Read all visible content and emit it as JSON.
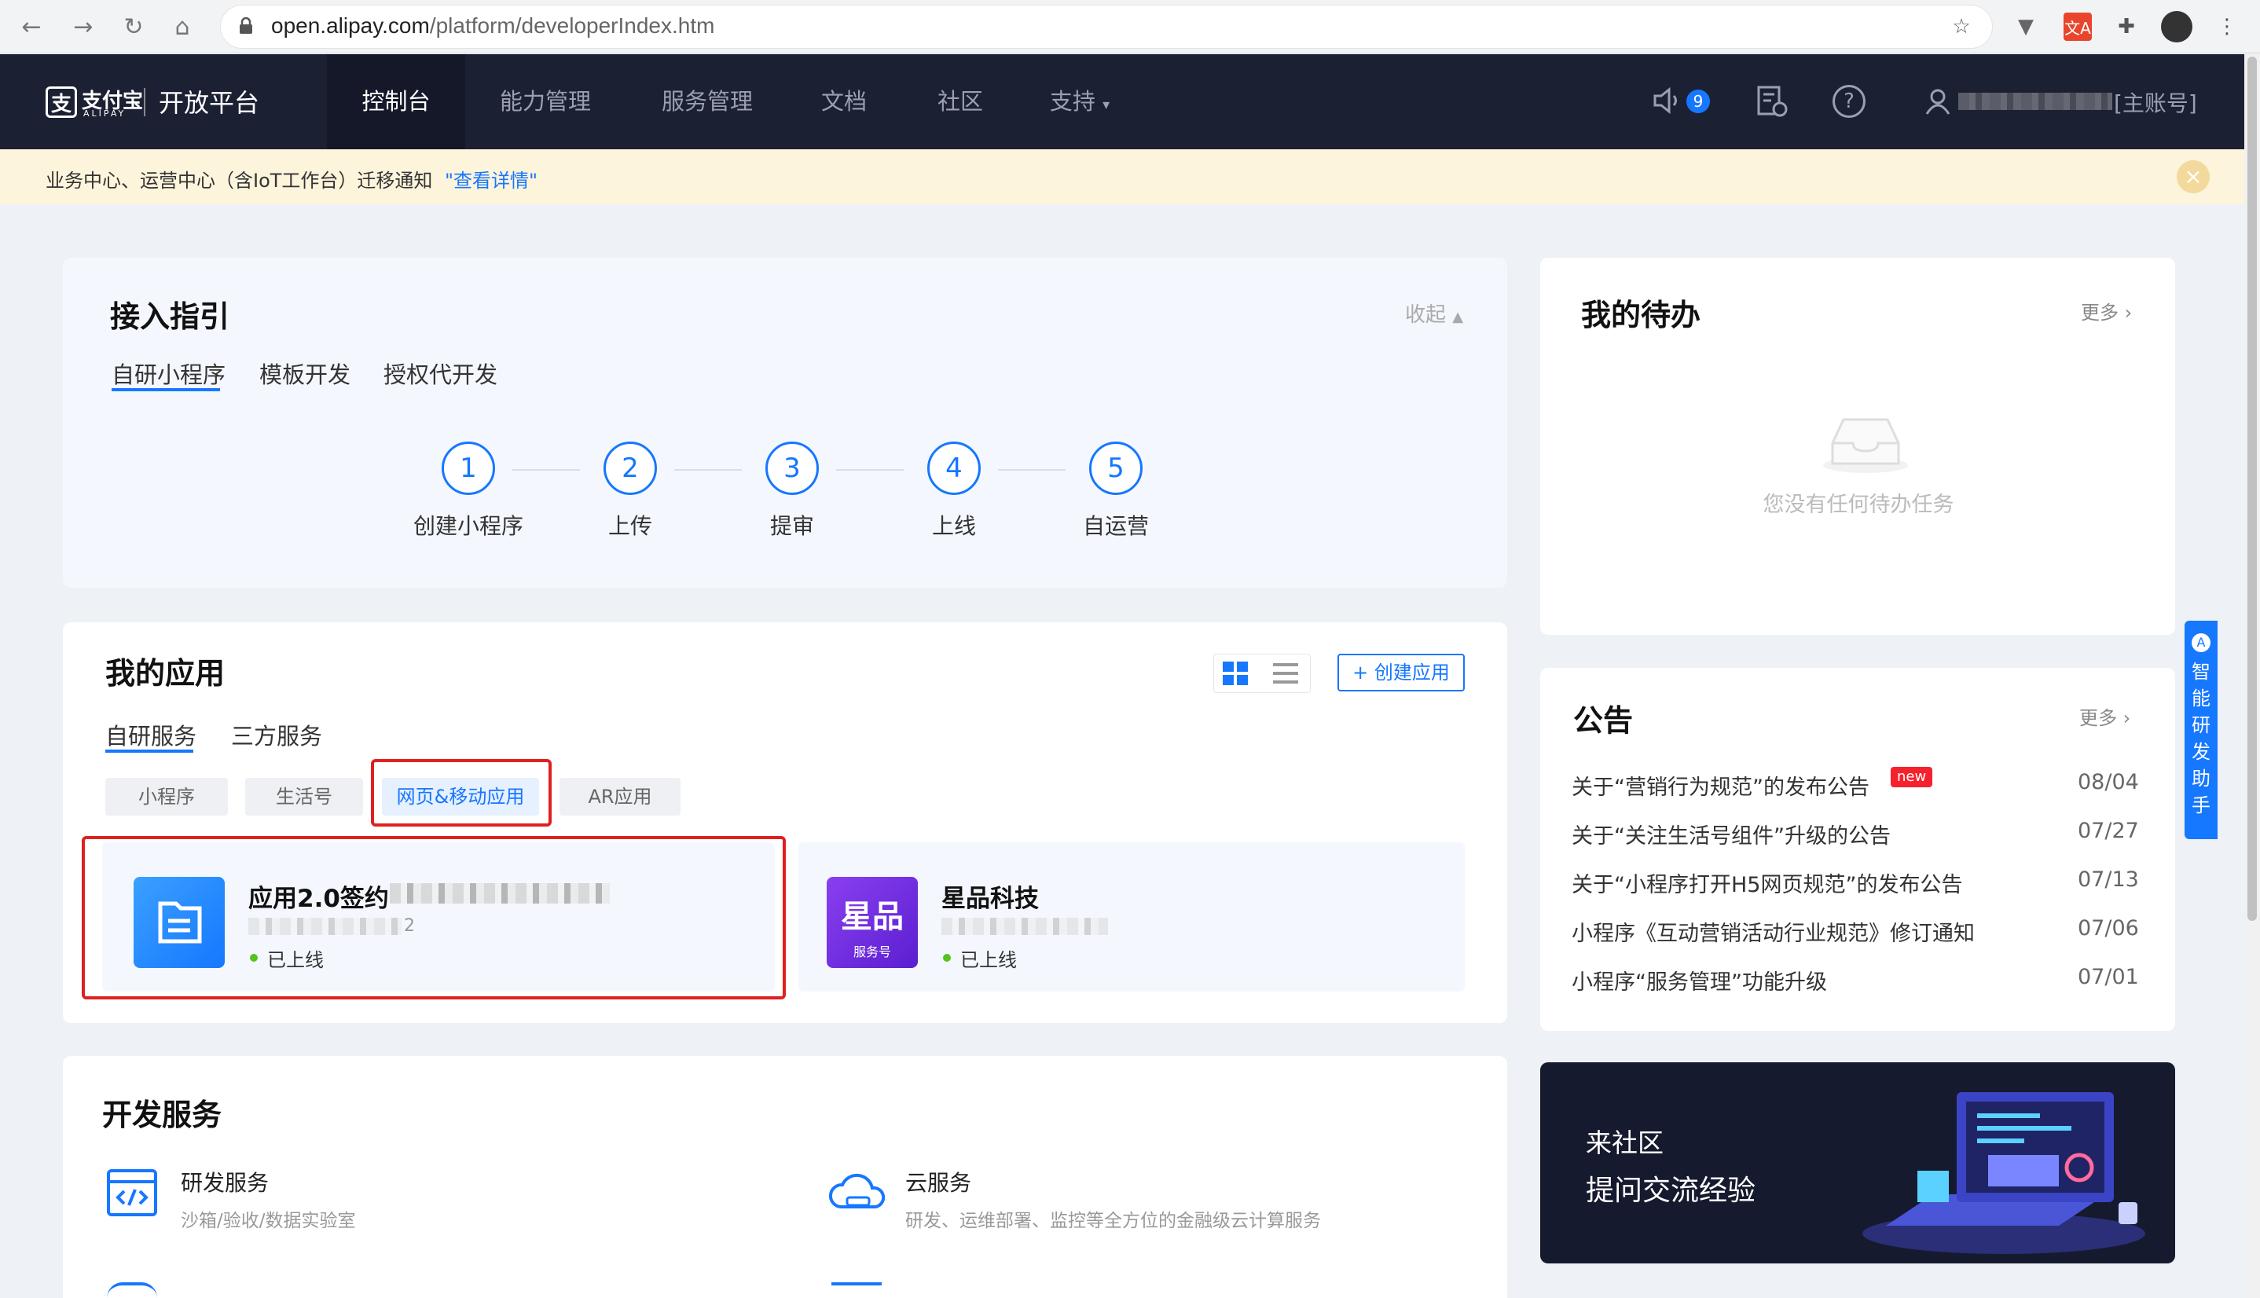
{
  "browser": {
    "url_host": "open.alipay.com",
    "url_path": "/platform/developerIndex.htm"
  },
  "header": {
    "logo_cn": "支付宝",
    "logo_en": "ALIPAY",
    "platform": "开放平台",
    "nav": [
      "控制台",
      "能力管理",
      "服务管理",
      "文档",
      "社区",
      "支持"
    ],
    "badge_count": "9",
    "account": "[主账号]"
  },
  "notice": {
    "text": "业务中心、运营中心（含IoT工作台）迁移通知",
    "link": "\"查看详情\""
  },
  "guide": {
    "title": "接入指引",
    "collapse": "收起",
    "tabs": [
      "自研小程序",
      "模板开发",
      "授权代开发"
    ],
    "steps": [
      {
        "num": "1",
        "label": "创建小程序"
      },
      {
        "num": "2",
        "label": "上传"
      },
      {
        "num": "3",
        "label": "提审"
      },
      {
        "num": "4",
        "label": "上线"
      },
      {
        "num": "5",
        "label": "自运营"
      }
    ]
  },
  "apps": {
    "title": "我的应用",
    "create": "创建应用",
    "tabs": [
      "自研服务",
      "三方服务"
    ],
    "chips": [
      "小程序",
      "生活号",
      "网页&移动应用",
      "AR应用"
    ],
    "cards": [
      {
        "name": "应用2.0签约",
        "id_suffix": "2",
        "status": "已上线"
      },
      {
        "name": "星品科技",
        "icon_text": "星品",
        "icon_sub": "服务号",
        "status": "已上线"
      }
    ]
  },
  "dev": {
    "title": "开发服务",
    "items": [
      {
        "name": "研发服务",
        "desc": "沙箱/验收/数据实验室"
      },
      {
        "name": "云服务",
        "desc": "研发、运维部署、监控等全方位的金融级云计算服务"
      }
    ]
  },
  "todo": {
    "title": "我的待办",
    "more": "更多",
    "empty": "您没有任何待办任务"
  },
  "announce": {
    "title": "公告",
    "more": "更多",
    "new_tag": "new",
    "items": [
      {
        "text": "关于“营销行为规范”的发布公告",
        "date": "08/04"
      },
      {
        "text": "关于“关注生活号组件”升级的公告",
        "date": "07/27"
      },
      {
        "text": "关于“小程序打开H5网页规范”的发布公告",
        "date": "07/13"
      },
      {
        "text": "小程序《互动营销活动行业规范》修订通知",
        "date": "07/06"
      },
      {
        "text": "小程序“服务管理”功能升级",
        "date": "07/01"
      }
    ]
  },
  "community": {
    "line1": "来社区",
    "line2": "提问交流经验"
  },
  "assistant": {
    "label": "智能研发助手"
  },
  "colors": {
    "nav_bg": "#1c2033",
    "primary": "#1677ff",
    "highlight": "#e02020"
  }
}
